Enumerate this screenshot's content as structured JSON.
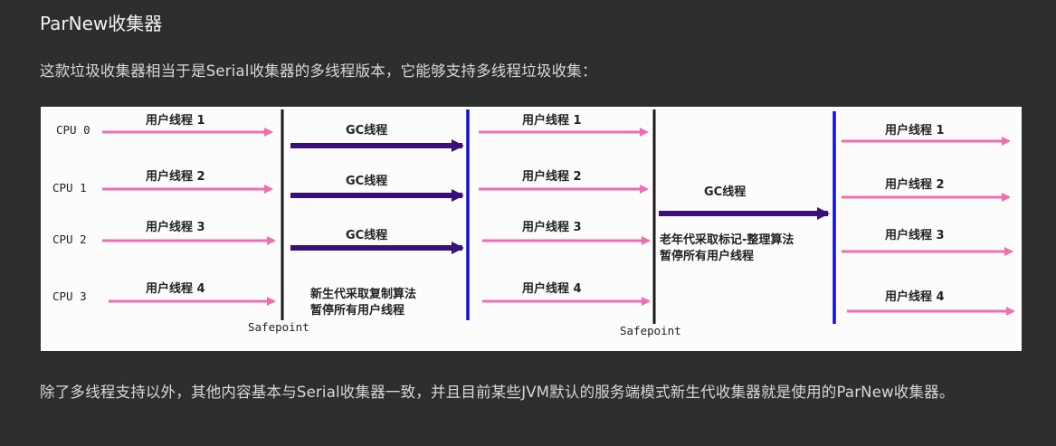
{
  "title": "ParNew收集器",
  "paragraph1": "这款垃圾收集器相当于是Serial收集器的多线程版本，它能够支持多线程垃圾收集：",
  "paragraph2": "除了多线程支持以外，其他内容基本与Serial收集器一致，并且目前某些JVM默认的服务端模式新生代收集器就是使用的ParNew收集器。",
  "diagram": {
    "cpus": [
      "CPU 0",
      "CPU 1",
      "CPU 2",
      "CPU 3"
    ],
    "user_threads": [
      "用户线程 1",
      "用户线程 2",
      "用户线程 3",
      "用户线程 4"
    ],
    "gc_thread": "GC线程",
    "young_note_1": "新生代采取复制算法",
    "young_note_2": "暂停所有用户线程",
    "old_note_1": "老年代采取标记-整理算法",
    "old_note_2": "暂停所有用户线程",
    "safepoint": "Safepoint",
    "colors": {
      "user_arrow": "#ef6db0",
      "gc_arrow": "#3b0f7a",
      "blue_line": "#1010d8",
      "black_line": "#1a1a1a"
    }
  }
}
